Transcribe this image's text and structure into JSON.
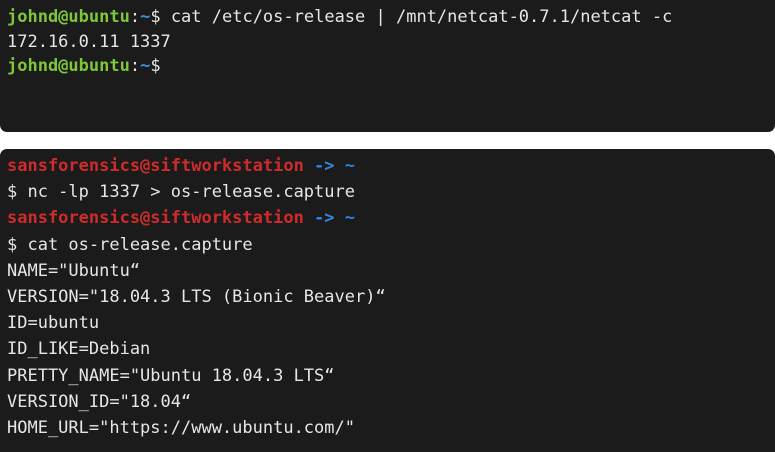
{
  "terminal_top": {
    "lines": [
      {
        "user": "johnd@ubuntu",
        "sep": ":",
        "path": "~",
        "symbol": "$ ",
        "command": "cat /etc/os-release | /mnt/netcat-0.7.1/netcat -c"
      },
      {
        "output": "172.16.0.11 1337"
      },
      {
        "user": "johnd@ubuntu",
        "sep": ":",
        "path": "~",
        "symbol": "$",
        "command": ""
      }
    ]
  },
  "terminal_bottom": {
    "prompt1": {
      "user": "sansforensics@siftworkstation",
      "arrow": " -> ~"
    },
    "command1": "$ nc -lp 1337 > os-release.capture",
    "prompt2": {
      "user": "sansforensics@siftworkstation",
      "arrow": " -> ~"
    },
    "command2": "$ cat os-release.capture",
    "output": [
      "NAME=\"Ubuntu“",
      "VERSION=\"18.04.3 LTS (Bionic Beaver)“",
      "ID=ubuntu",
      "ID_LIKE=Debian",
      "PRETTY_NAME=\"Ubuntu 18.04.3 LTS“",
      "VERSION_ID=\"18.04“",
      "HOME_URL=\"https://www.ubuntu.com/\""
    ]
  },
  "colors": {
    "background": "#1b1b1b",
    "text": "#e6e6e6",
    "user_green": "#7ec63a",
    "path_blue": "#3f8fe6",
    "user_red": "#cf2b2b"
  }
}
